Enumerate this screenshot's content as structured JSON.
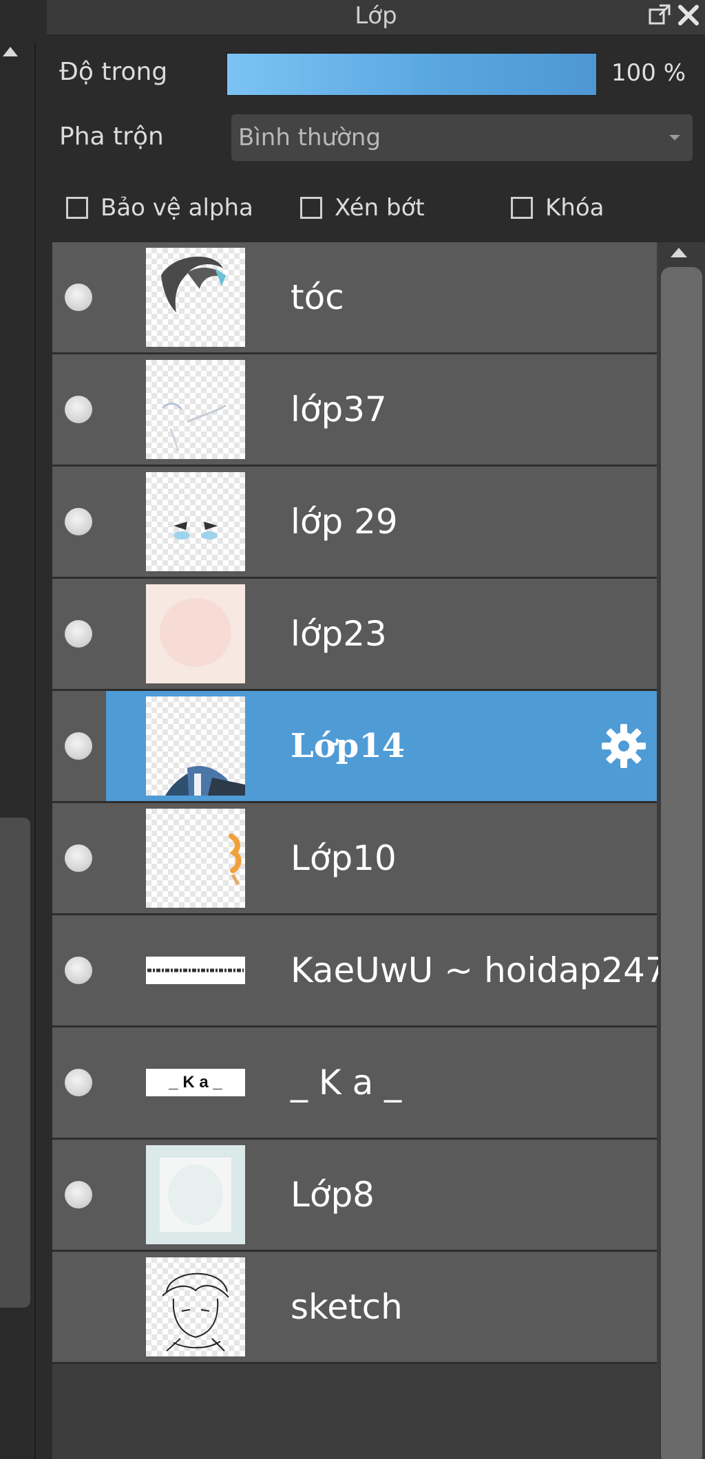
{
  "panel": {
    "title": "Lớp"
  },
  "opacity": {
    "label": "Độ trong",
    "value_text": "100 %",
    "level": 1.0
  },
  "blend": {
    "label": "Pha trộn",
    "value": "Bình thường"
  },
  "checkboxes": {
    "protect_alpha": "Bảo vệ alpha",
    "clip": "Xén bớt",
    "lock": "Khóa"
  },
  "layers": [
    {
      "name": "tóc",
      "visible": true,
      "selected": false
    },
    {
      "name": "lớp37",
      "visible": true,
      "selected": false
    },
    {
      "name": "lớp 29",
      "visible": true,
      "selected": false
    },
    {
      "name": "lớp23",
      "visible": true,
      "selected": false
    },
    {
      "name": "Lớp14",
      "visible": true,
      "selected": true
    },
    {
      "name": "Lớp10",
      "visible": true,
      "selected": false
    },
    {
      "name": "KaeUwU ~ hoidap247",
      "visible": true,
      "selected": false
    },
    {
      "name": "_ K a _",
      "visible": true,
      "selected": false
    },
    {
      "name": "Lớp8",
      "visible": true,
      "selected": false
    },
    {
      "name": "sketch",
      "visible": false,
      "selected": false
    }
  ],
  "thumb_text": {
    "ka": "_ K a _"
  },
  "colors": {
    "accent": "#4f9bd6",
    "row": "#5a5a5a",
    "panel": "#2b2b2b"
  }
}
